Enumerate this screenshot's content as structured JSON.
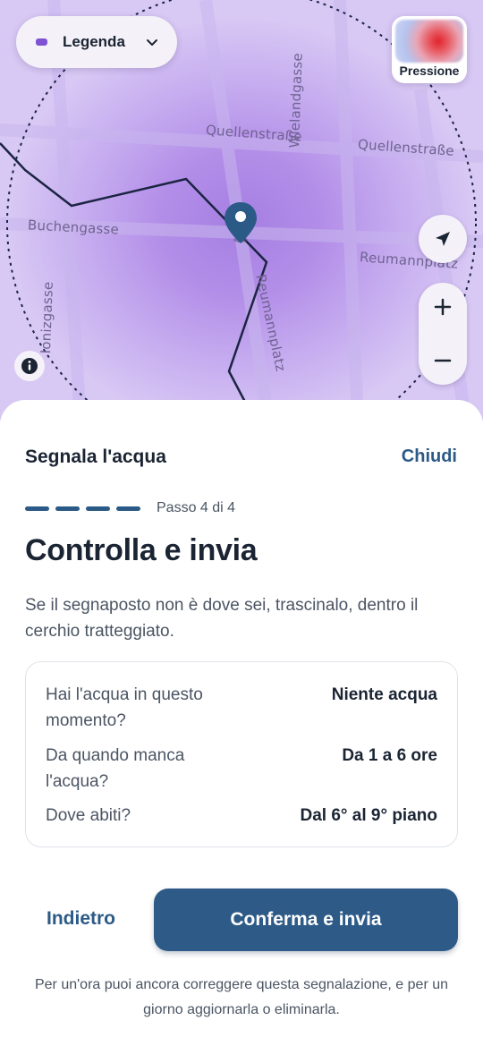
{
  "map": {
    "streets": {
      "quellenstrasse_1": "Quellenstraße",
      "quellenstrasse_2": "Quellenstraße",
      "wielandgasse": "Wielandgasse",
      "buchengasse": "Buchengasse",
      "reumannplatz_1": "Reumannplatz",
      "reumannplatz_2": "Reumannplatz",
      "ionizgasse": "Ionizgasse"
    },
    "legend": {
      "label": "Legenda",
      "dot_color": "#7e52d4"
    },
    "pressure_layer": {
      "label": "Pressione"
    },
    "controls": {
      "locate_icon": "navigation-arrow-icon",
      "zoom_in_icon": "plus-icon",
      "zoom_out_icon": "minus-icon",
      "info_icon": "info-icon"
    }
  },
  "sheet": {
    "title": "Segnala l'acqua",
    "close_label": "Chiudi",
    "step": {
      "text": "Passo 4 di 4",
      "current": 4,
      "total": 4
    },
    "headline": "Controlla e invia",
    "instructions": "Se il segnaposto non è dove sei, trascinalo, dentro il cerchio tratteggiato.",
    "summary": [
      {
        "question": "Hai l'acqua in questo momento?",
        "answer": "Niente acqua"
      },
      {
        "question": "Da quando manca l'acqua?",
        "answer": "Da 1 a 6 ore"
      },
      {
        "question": "Dove abiti?",
        "answer": "Dal 6° al 9° piano"
      }
    ],
    "back_label": "Indietro",
    "confirm_label": "Conferma e invia",
    "footnote": "Per un'ora puoi ancora correggere questa segnalazione, e per un giorno aggiornarla o eliminarla."
  },
  "colors": {
    "accent": "#2c5a86",
    "map_purple": "#a57fe2"
  }
}
